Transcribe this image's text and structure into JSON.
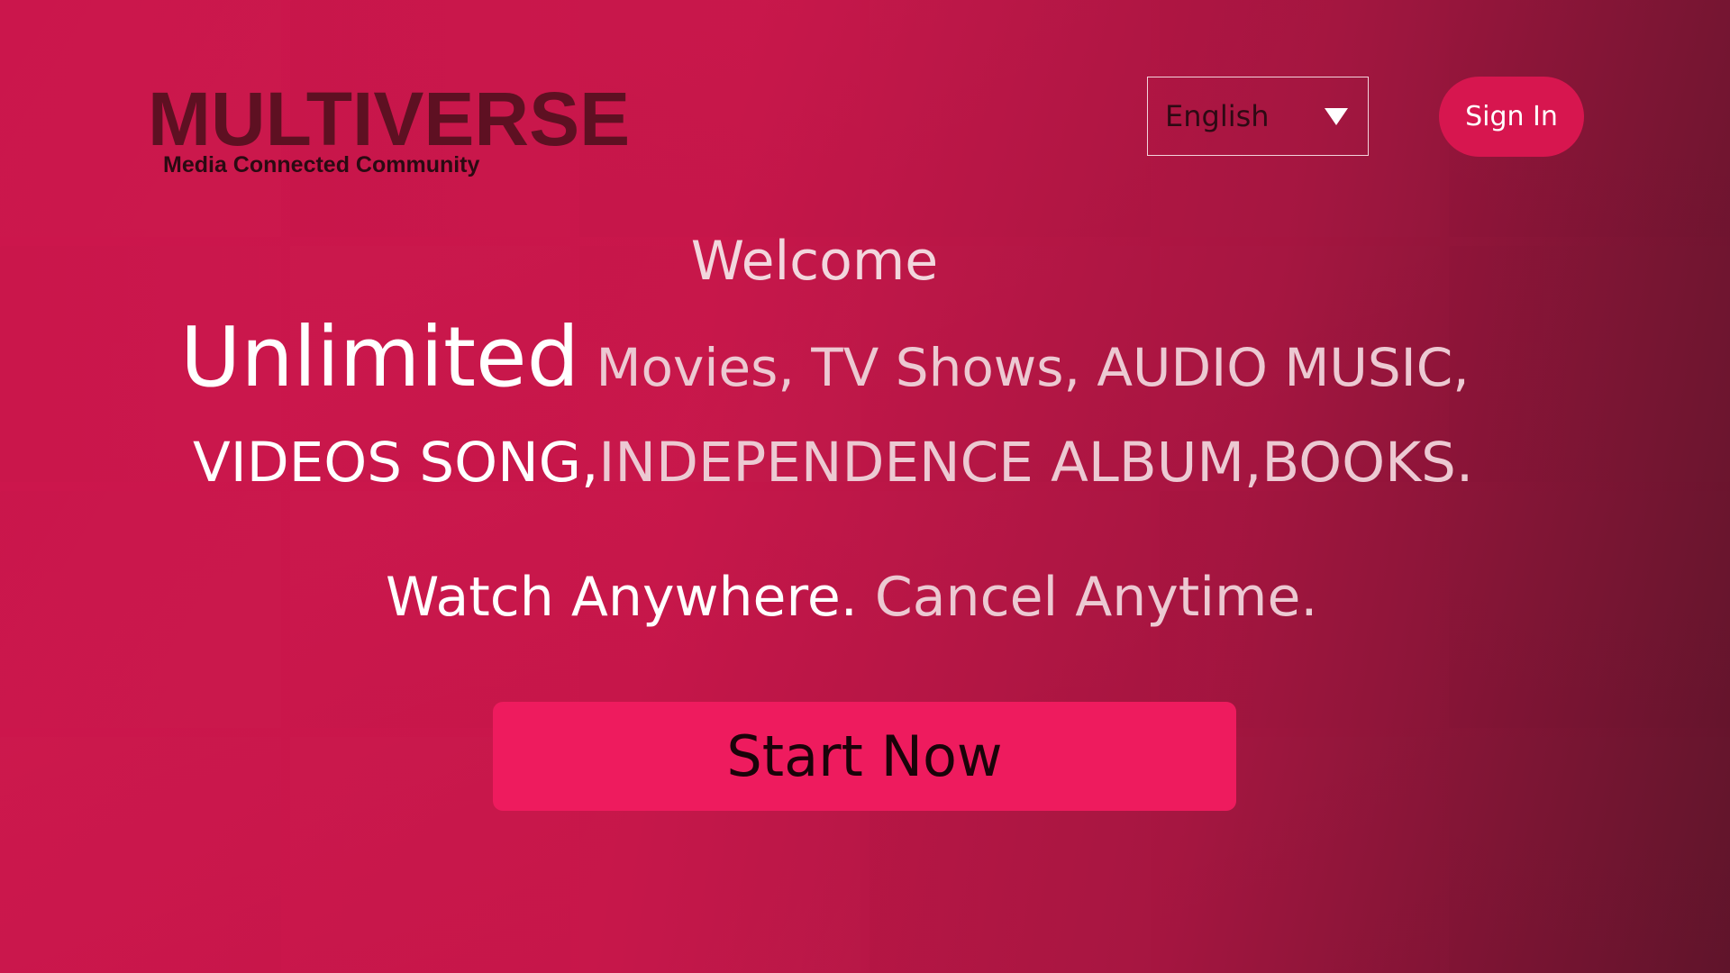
{
  "header": {
    "brand": "MULTIVERSE",
    "tagline": "Media Connected Community",
    "language_select": {
      "value": "English"
    },
    "sign_in_label": "Sign In"
  },
  "hero": {
    "welcome": "Welcome",
    "line1_highlight": "Unlimited",
    "line1_rest": " Movies, TV Shows, AUDIO MUSIC,",
    "line2_a": "VIDEOS SONG,",
    "line2_b": "INDEPENDENCE ALBUM,BOOKS.",
    "line3_a": "Watch Anywhere.",
    "line3_b": " Cancel Anytime.",
    "cta_label": "Start Now"
  },
  "colors": {
    "background": "#c81a4d",
    "button_primary": "#ee1b5e",
    "button_signin": "#d7164f",
    "logo": "#5e1022"
  },
  "icons": {
    "language_dropdown": "chevron-down-icon"
  }
}
